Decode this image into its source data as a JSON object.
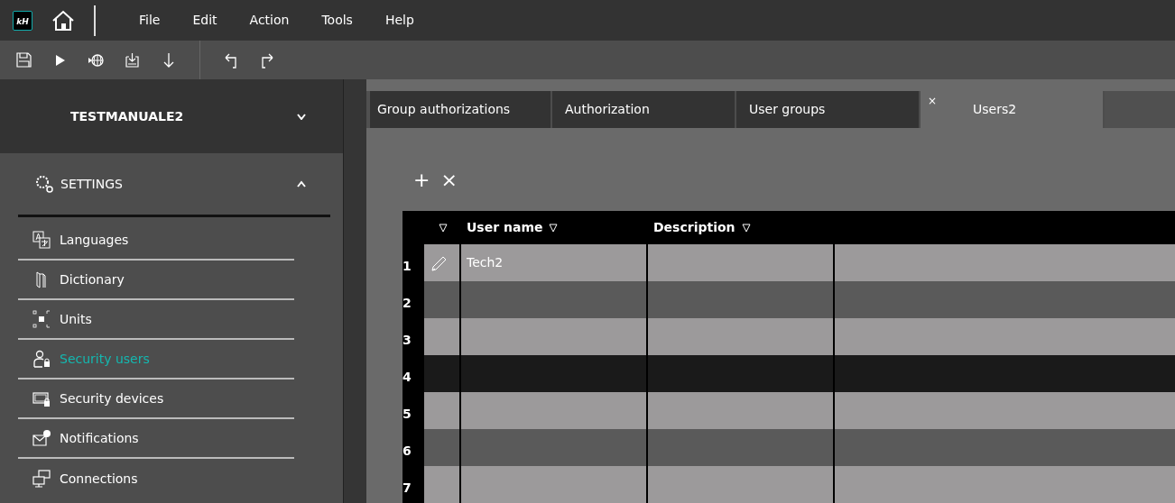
{
  "menu": [
    "File",
    "Edit",
    "Action",
    "Tools",
    "Help"
  ],
  "logo": {
    "text": "kH"
  },
  "sidebar": {
    "project": "TESTMANUALE2",
    "project_expanded": false,
    "section": {
      "label": "SETTINGS",
      "expanded": true
    },
    "items": [
      {
        "label": "Languages",
        "selected": false
      },
      {
        "label": "Dictionary",
        "selected": false
      },
      {
        "label": "Units",
        "selected": false
      },
      {
        "label": "Security users",
        "selected": true
      },
      {
        "label": "Security devices",
        "selected": false
      },
      {
        "label": "Notifications",
        "selected": false
      },
      {
        "label": "Connections",
        "selected": false
      }
    ]
  },
  "tabs": [
    {
      "label": "Group authorizations",
      "selected": false
    },
    {
      "label": "Authorization",
      "selected": false
    },
    {
      "label": "User groups",
      "selected": false
    },
    {
      "label": "Users2",
      "selected": true,
      "close": "×"
    }
  ],
  "table": {
    "actions": [
      "+",
      "×"
    ],
    "columns": [
      "User name",
      "Description"
    ],
    "rows": [
      {
        "number": "1",
        "user_name": "Tech2",
        "editing": true,
        "selected": false
      },
      {
        "number": "2",
        "editing": false,
        "selected": false
      },
      {
        "number": "3",
        "editing": false,
        "selected": false
      },
      {
        "number": "4",
        "editing": false,
        "selected": true
      },
      {
        "number": "5",
        "editing": false,
        "selected": false
      },
      {
        "number": "6",
        "editing": false,
        "selected": false
      },
      {
        "number": "7",
        "editing": false,
        "selected": false
      }
    ]
  }
}
